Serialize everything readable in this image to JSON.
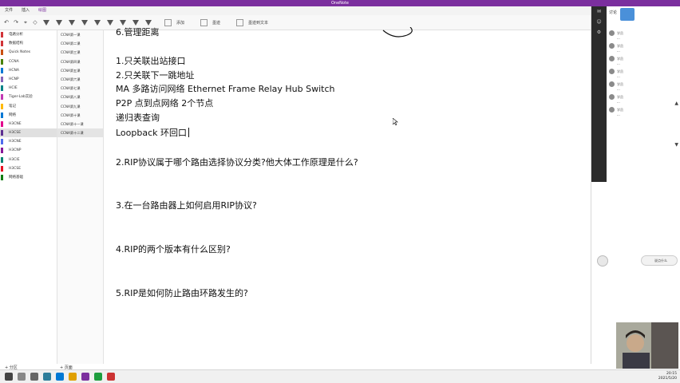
{
  "window": {
    "title": "OneNote"
  },
  "menu_tabs": [
    "文件",
    "插入",
    "绘图"
  ],
  "toolbar": {
    "items": [
      "撤销",
      "重做",
      "套索",
      "橡皮擦",
      "笔",
      "笔",
      "笔",
      "笔",
      "笔",
      "笔",
      "笔",
      "笔",
      "笔",
      "添加",
      "墨迹",
      "墨迹到文本"
    ]
  },
  "search": {
    "placeholder": "搜索"
  },
  "sections": [
    {
      "label": "电路分析",
      "color": "#d13438"
    },
    {
      "label": "数据结构",
      "color": "#d13438"
    },
    {
      "label": "Quick Notes",
      "color": "#ca5010"
    },
    {
      "label": "CCNA",
      "color": "#498205"
    },
    {
      "label": "HCNA",
      "color": "#0078d4"
    },
    {
      "label": "HCNP",
      "color": "#8764b8"
    },
    {
      "label": "HCIE",
      "color": "#038387"
    },
    {
      "label": "Tiger-Lab实验",
      "color": "#c239b3"
    },
    {
      "label": "笔记",
      "color": "#ffb900"
    },
    {
      "label": "网络",
      "color": "#0078d4"
    },
    {
      "label": "H3CNE",
      "color": "#e3008c"
    },
    {
      "label": "H3CSE",
      "color": "#5c2e91"
    },
    {
      "label": "H3CNE",
      "color": "#4f6bed"
    },
    {
      "label": "H3CNP",
      "color": "#881798"
    },
    {
      "label": "H3CIE",
      "color": "#008272"
    },
    {
      "label": "H3CSE",
      "color": "#e81123"
    },
    {
      "label": "网络基础",
      "color": "#107c10"
    }
  ],
  "selected_section": 11,
  "pages": [
    "CCNA第一课",
    "CCNA第二课",
    "CCNA第三课",
    "CCNA第四课",
    "CCNA第五课",
    "CCNA第六课",
    "CCNA第七课",
    "CCNA第八课",
    "CCNA第九课",
    "CCNA第十课",
    "CCNA第十一课",
    "CCNA第十二课"
  ],
  "selected_page": 11,
  "add_section_label": "+ 分区",
  "add_page_label": "+ 页面",
  "note": {
    "lines": [
      "6.管理距离",
      "1.只关联出站接口",
      "2.只关联下一跳地址",
      "MA 多路访问网络 Ethernet Frame Relay Hub Switch",
      "P2P 点到点网络 2个节点",
      "递归表查询",
      "Loopback 环回口",
      "2.RIP协议属于哪个路由选择协议分类?他大体工作原理是什么?",
      "3.在一台路由器上如何启用RIP协议?",
      "4.RIP的两个版本有什么区别?",
      "5.RIP是如何防止路由环路发生的?"
    ]
  },
  "chat": {
    "header": "讨论",
    "messages": [
      {
        "name": "学员",
        "text": "..."
      },
      {
        "name": "学员",
        "text": "..."
      },
      {
        "name": "学员",
        "text": "..."
      },
      {
        "name": "学员",
        "text": "..."
      },
      {
        "name": "学员",
        "text": "..."
      },
      {
        "name": "学员",
        "text": "..."
      },
      {
        "name": "学员",
        "text": "..."
      }
    ],
    "input_placeholder": "说点什么"
  },
  "taskbar": {
    "time": "20:15",
    "date": "2021/5/20"
  }
}
